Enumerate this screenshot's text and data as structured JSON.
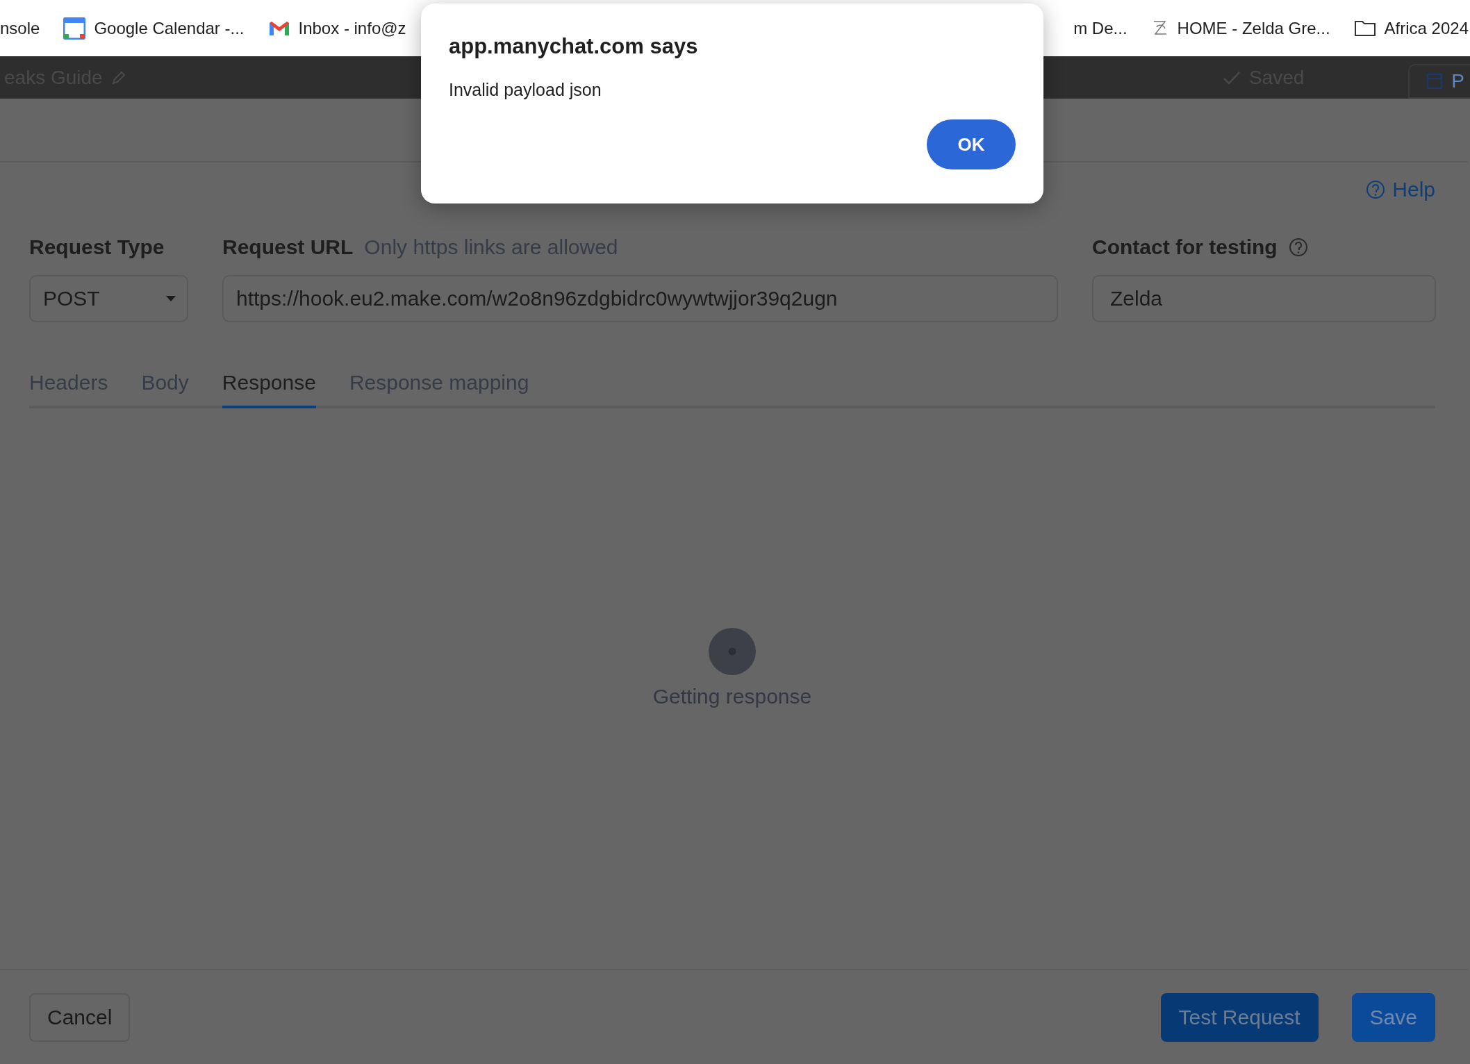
{
  "bookmarks": {
    "left": [
      {
        "label": "nsole",
        "kind": "plain"
      },
      {
        "label": "Google Calendar -...",
        "kind": "calendar"
      },
      {
        "label": "Inbox - info@z",
        "kind": "mail"
      }
    ],
    "right": [
      {
        "label": "m De...",
        "kind": "plain"
      },
      {
        "label": "HOME - Zelda Gre...",
        "kind": "logo"
      },
      {
        "label": "Africa 2024",
        "kind": "folder"
      }
    ]
  },
  "app_header": {
    "title": "eaks Guide",
    "status": "Saved",
    "button": "P"
  },
  "modal": {
    "help": "Help",
    "request_type": {
      "label": "Request Type",
      "value": "POST"
    },
    "request_url": {
      "label": "Request URL",
      "hint": "Only https links are allowed",
      "value": "https://hook.eu2.make.com/w2o8n96zdgbidrc0wywtwjjor39q2ugn"
    },
    "contact": {
      "label": "Contact for testing",
      "value": "Zelda"
    },
    "tabs": [
      {
        "label": "Headers",
        "selected": false
      },
      {
        "label": "Body",
        "selected": false
      },
      {
        "label": "Response",
        "selected": true
      },
      {
        "label": "Response mapping",
        "selected": false
      }
    ],
    "status": "Getting response",
    "footer": {
      "cancel": "Cancel",
      "test": "Test Request",
      "save": "Save"
    }
  },
  "alert": {
    "title": "app.manychat.com says",
    "message": "Invalid payload json",
    "button": "OK"
  }
}
